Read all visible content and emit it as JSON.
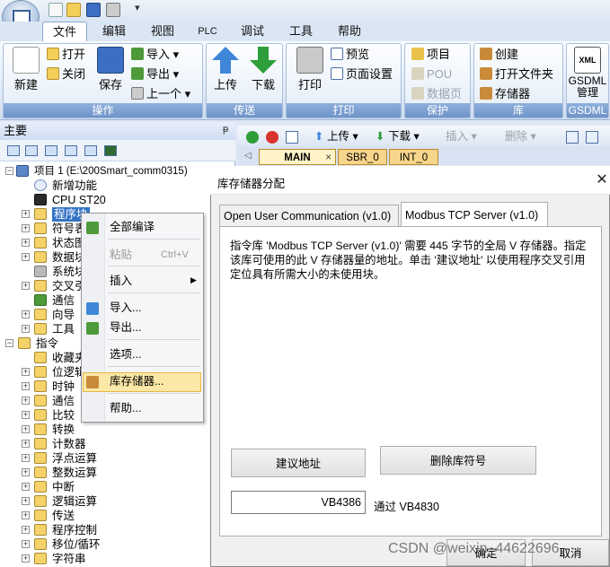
{
  "quick_access": {
    "more_glyph": "▾"
  },
  "menu_tabs": [
    "文件",
    "编辑",
    "视图",
    "PLC",
    "调试",
    "工具",
    "帮助"
  ],
  "ribbon": {
    "operations": {
      "label": "操作",
      "new": "新建",
      "open": "打开",
      "close": "关闭",
      "save": "保存",
      "import": "导入",
      "export": "导出",
      "previous": "上一个"
    },
    "transfer": {
      "label": "传送",
      "upload": "上传",
      "download": "下载"
    },
    "print": {
      "label": "打印",
      "print": "打印",
      "preview": "预览",
      "page_setup": "页面设置"
    },
    "protect": {
      "label": "保护",
      "project": "项目",
      "pou": "POU",
      "data_page": "数据页"
    },
    "library": {
      "label": "库",
      "create": "创建",
      "open_folder": "打开文件夹",
      "memory": "存储器"
    },
    "gsdml": {
      "label": "GSDML",
      "manage": "GSDML\n管理",
      "badge": "XML"
    }
  },
  "left_panel": {
    "title": "主要",
    "pin": "ᵽ",
    "tree": [
      {
        "label": "项目 1 (E:\\200Smart_comm0315)"
      },
      {
        "label": "新增功能"
      },
      {
        "label": "CPU ST20"
      },
      {
        "label": "程序块"
      },
      {
        "label": "符号表"
      },
      {
        "label": "状态图"
      },
      {
        "label": "数据块"
      },
      {
        "label": "系统块"
      },
      {
        "label": "交叉引"
      },
      {
        "label": "通信"
      },
      {
        "label": "向导"
      },
      {
        "label": "工具"
      },
      {
        "label": "指令"
      },
      {
        "label": "收藏夹"
      },
      {
        "label": "位逻辑"
      },
      {
        "label": "时钟"
      },
      {
        "label": "通信"
      },
      {
        "label": "比较"
      },
      {
        "label": "转换"
      },
      {
        "label": "计数器"
      },
      {
        "label": "浮点运算"
      },
      {
        "label": "整数运算"
      },
      {
        "label": "中断"
      },
      {
        "label": "逻辑运算"
      },
      {
        "label": "传送"
      },
      {
        "label": "程序控制"
      },
      {
        "label": "移位/循环"
      },
      {
        "label": "字符串"
      }
    ]
  },
  "context_menu": {
    "compile_all": "全部编译",
    "paste": "粘贴",
    "paste_shortcut": "Ctrl+V",
    "insert": "插入",
    "import": "导入...",
    "export": "导出...",
    "options": "选项...",
    "library_memory": "库存储器...",
    "help": "帮助...",
    "submenu_arrow": "▶"
  },
  "editor": {
    "upload": "上传",
    "download": "下载",
    "insert": "插入",
    "delete": "删除",
    "tabs": [
      "MAIN",
      "SBR_0",
      "INT_0"
    ],
    "tab_close": "×"
  },
  "dialog": {
    "title": "库存储器分配",
    "close": "✕",
    "tabs": [
      "Open User Communication (v1.0)",
      "Modbus TCP Server (v1.0)"
    ],
    "description": "指令库 'Modbus TCP Server (v1.0)' 需要 445 字节的全局 V 存储器。指定该库可使用的此 V 存储器量的地址。单击 '建议地址' 以使用程序交叉引用定位具有所需大小的未使用块。",
    "suggest_button": "建议地址",
    "delete_button": "删除库符号",
    "address": "VB4386",
    "through": "通过 VB4830",
    "ok_button": "确定",
    "cancel_button": "取消"
  },
  "watermark": "CSDN @weixin_44622696"
}
